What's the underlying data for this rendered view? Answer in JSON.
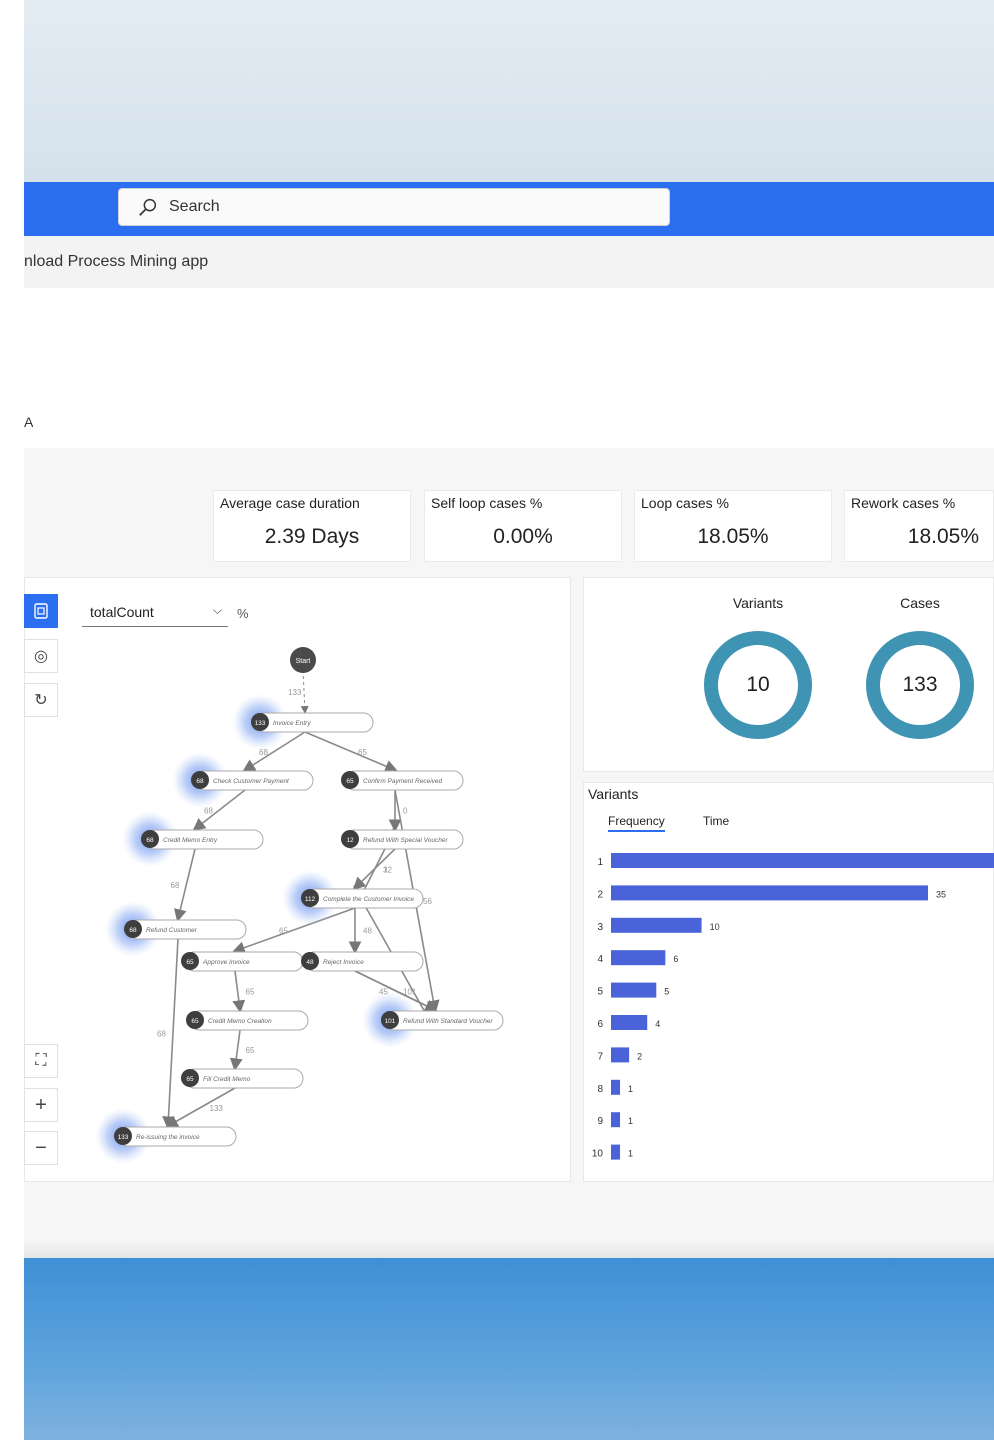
{
  "search": {
    "placeholder": "Search"
  },
  "subbar": {
    "text": "nload Process Mining app"
  },
  "page": {
    "title_fragment": "A"
  },
  "kpis": [
    {
      "label": "Average case duration",
      "value": "2.39 Days"
    },
    {
      "label": "Self loop cases %",
      "value": "0.00%"
    },
    {
      "label": "Loop cases %",
      "value": "18.05%"
    },
    {
      "label": "Rework cases %",
      "value": "18.05%"
    }
  ],
  "graph": {
    "metric_select": "totalCount",
    "percent_toggle": "%",
    "side_buttons": [
      "map-view-icon",
      "coin-icon",
      "refresh-icon"
    ],
    "zoom_buttons": [
      "fit-screen-icon",
      "zoom-in-icon",
      "zoom-out-icon"
    ],
    "nodes": [
      {
        "id": "start",
        "label": "Start",
        "count": ""
      },
      {
        "id": "invoice-entry",
        "label": "Invoice Entry",
        "count": "133"
      },
      {
        "id": "check-payment",
        "label": "Check Customer Payment",
        "count": "68"
      },
      {
        "id": "confirm-payment",
        "label": "Confirm Payment Received",
        "count": "65"
      },
      {
        "id": "credit-memo-entry",
        "label": "Credit Memo Entry",
        "count": "68"
      },
      {
        "id": "refund-special",
        "label": "Refund With Special Voucher",
        "count": "12"
      },
      {
        "id": "complete-invoice",
        "label": "Complete the Customer Invoice",
        "count": "112"
      },
      {
        "id": "refund-customer",
        "label": "Refund Customer",
        "count": "68"
      },
      {
        "id": "approve-invoice",
        "label": "Approve Invoice",
        "count": "65"
      },
      {
        "id": "reject-invoice",
        "label": "Reject Invoice",
        "count": "48"
      },
      {
        "id": "credit-memo-creation",
        "label": "Credit Memo Creation",
        "count": "65"
      },
      {
        "id": "refund-standard",
        "label": "Refund With Standard Voucher",
        "count": "101"
      },
      {
        "id": "fill-credit-memo",
        "label": "Fill Credit Memo",
        "count": "65"
      },
      {
        "id": "reissue-invoice",
        "label": "Re-issuing the invoice",
        "count": "133"
      }
    ],
    "edges": [
      {
        "value": "133"
      },
      {
        "value": "68"
      },
      {
        "value": "65"
      },
      {
        "value": "68"
      },
      {
        "value": "0"
      },
      {
        "value": "68"
      },
      {
        "value": "12"
      },
      {
        "value": "3"
      },
      {
        "value": "56"
      },
      {
        "value": "65"
      },
      {
        "value": "48"
      },
      {
        "value": "65"
      },
      {
        "value": "101"
      },
      {
        "value": "45"
      },
      {
        "value": "68"
      },
      {
        "value": "65"
      },
      {
        "value": "65"
      },
      {
        "value": "133"
      }
    ]
  },
  "donuts": [
    {
      "title": "Variants",
      "value": "10"
    },
    {
      "title": "Cases",
      "value": "133"
    }
  ],
  "variants": {
    "title": "Variants",
    "tabs": [
      "Frequency",
      "Time"
    ],
    "active_tab": "Frequency",
    "bar_color": "#4a63d8"
  },
  "chart_data": {
    "type": "bar",
    "orientation": "horizontal",
    "categories": [
      "1",
      "2",
      "3",
      "4",
      "5",
      "6",
      "7",
      "8",
      "9",
      "10"
    ],
    "values": [
      null,
      35,
      10,
      6,
      5,
      4,
      2,
      1,
      1,
      1
    ],
    "value_labels": [
      "",
      "35",
      "10",
      "6",
      "5",
      "4",
      "2",
      "1",
      "1",
      "1"
    ],
    "xlim": [
      0,
      35
    ],
    "note_first_bar": "extends beyond visible area"
  },
  "colors": {
    "header_blue": "#2b6ef0",
    "donut_ring": "#3f93b3",
    "bar": "#4a63d8"
  }
}
